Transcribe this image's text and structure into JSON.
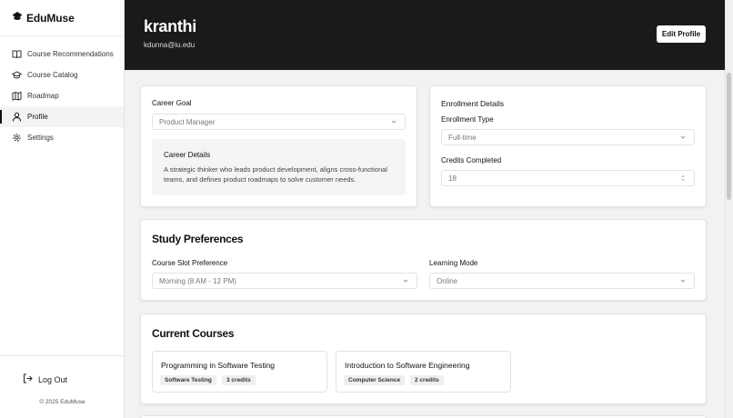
{
  "brand": {
    "name": "EduMuse"
  },
  "sidebar": {
    "items": [
      {
        "label": "Course Recommendations",
        "icon": "book-open-icon"
      },
      {
        "label": "Course Catalog",
        "icon": "graduation-cap-icon"
      },
      {
        "label": "Roadmap",
        "icon": "map-icon"
      },
      {
        "label": "Profile",
        "icon": "user-icon",
        "active": true
      },
      {
        "label": "Settings",
        "icon": "gear-icon"
      }
    ],
    "logout_label": "Log Out",
    "copyright": "© 2025 EduMuse"
  },
  "header": {
    "name": "kranthi",
    "email": "kdunna@iu.edu",
    "edit_label": "Edit Profile"
  },
  "career": {
    "goal_label": "Career Goal",
    "goal_value": "Product Manager",
    "details_title": "Career Details",
    "details_text": "A strategic thinker who leads product development, aligns cross-functional teams, and defines product roadmaps to solve customer needs."
  },
  "enrollment": {
    "title": "Enrollment Details",
    "type_label": "Enrollment Type",
    "type_value": "Full-time",
    "credits_label": "Credits Completed",
    "credits_value": "18"
  },
  "study": {
    "title": "Study Preferences",
    "slot_label": "Course Slot Preference",
    "slot_value": "Morning (8 AM - 12 PM)",
    "mode_label": "Learning Mode",
    "mode_value": "Online"
  },
  "courses": {
    "title": "Current Courses",
    "items": [
      {
        "title": "Programming in Software Testing",
        "dept": "Software Testing",
        "credits": "3 credits"
      },
      {
        "title": "Introduction to Software Engineering",
        "dept": "Computer Science",
        "credits": "2 credits"
      }
    ]
  },
  "colors": {
    "header_bg": "#1a1a1a",
    "accent": "#111111",
    "page_bg": "#f2f2f2"
  }
}
